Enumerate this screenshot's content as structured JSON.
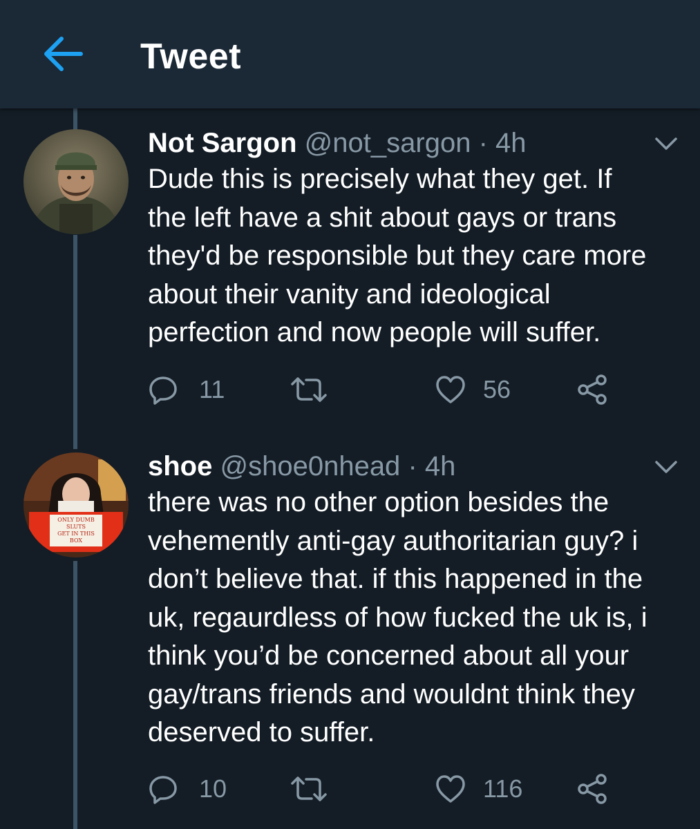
{
  "header": {
    "back_icon": "arrow-left-icon",
    "title": "Tweet"
  },
  "colors": {
    "accent": "#1da1f2",
    "background": "#141d26",
    "header": "#1b2836",
    "secondary_text": "#8899a6",
    "thread_line": "#3d5466"
  },
  "tweets": [
    {
      "display_name": "Not Sargon",
      "handle": "@not_sargon",
      "separator": "·",
      "time": "4h",
      "lines": [
        "Dude this is precisely what they get. If",
        "the left have a shit about gays or trans",
        "they'd be responsible but they care more",
        "about their vanity and ideological",
        "perfection and now people will suffer."
      ],
      "replies": "11",
      "retweets": "",
      "likes": "56"
    },
    {
      "display_name": "shoe",
      "handle": "@shoe0nhead",
      "separator": "·",
      "time": "4h",
      "lines": [
        "there was no other option besides the",
        "vehemently anti-gay authoritarian guy? i",
        "don’t believe that. if this happened in the",
        "uk, regaurdless of how fucked the uk is, i",
        "think you’d be concerned about all your",
        "gay/trans friends and wouldnt think they",
        "deserved to suffer."
      ],
      "replies": "10",
      "retweets": "",
      "likes": "116"
    }
  ]
}
